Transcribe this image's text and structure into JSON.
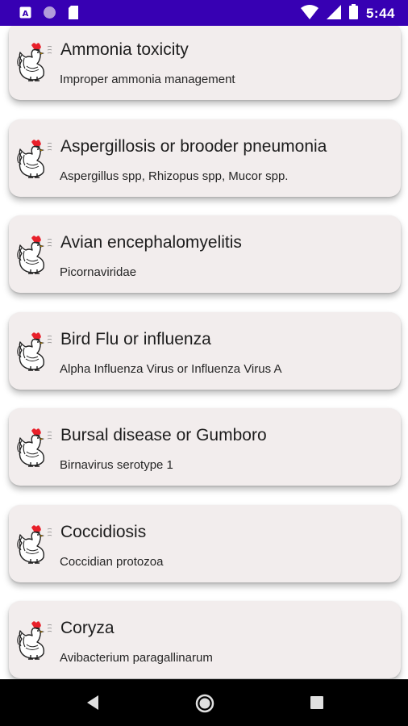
{
  "status_bar": {
    "time": "5:44",
    "left_icons": [
      "text-a-icon",
      "circle-icon",
      "sd-card-icon"
    ],
    "right_icons": [
      "wifi-icon",
      "signal-icon",
      "battery-icon"
    ],
    "background": "#3700b3"
  },
  "diseases": [
    {
      "title": "Ammonia toxicity",
      "subtitle": "Improper ammonia management"
    },
    {
      "title": "Aspergillosis or brooder pneumonia",
      "subtitle": "Aspergillus spp, Rhizopus spp, Mucor spp."
    },
    {
      "title": "Avian encephalomyelitis",
      "subtitle": "Picornaviridae"
    },
    {
      "title": "Bird Flu or influenza",
      "subtitle": "Alpha Influenza Virus or Influenza Virus A"
    },
    {
      "title": "Bursal disease or Gumboro",
      "subtitle": "Birnavirus serotype 1"
    },
    {
      "title": "Coccidiosis",
      "subtitle": "Coccidian protozoa"
    },
    {
      "title": "Coryza",
      "subtitle": "Avibacterium paragallinarum"
    }
  ],
  "card_icon": "rooster-icon",
  "navigation": {
    "buttons": [
      "back-icon",
      "home-icon",
      "recents-icon"
    ]
  },
  "colors": {
    "card_background": "#f2eded",
    "rooster_comb": "#e8202a"
  }
}
